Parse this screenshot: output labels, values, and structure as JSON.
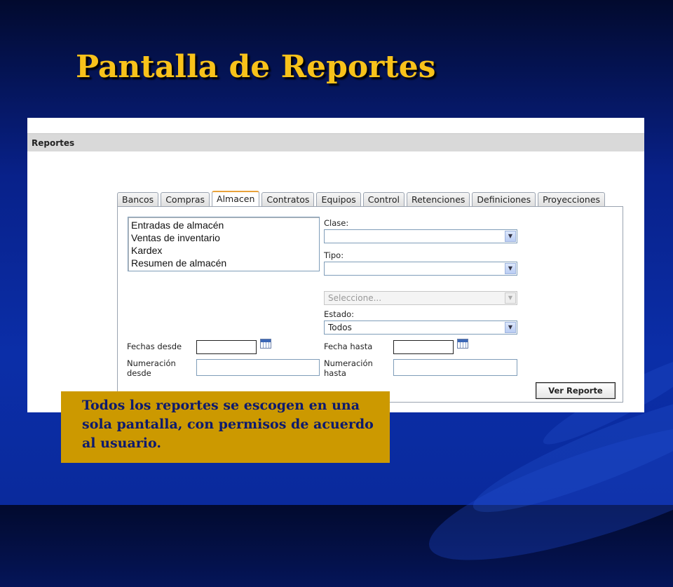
{
  "slide": {
    "title": "Pantalla de Reportes",
    "caption": "Todos los reportes se escogen en una sola pantalla, con permisos de acuerdo al usuario."
  },
  "app": {
    "header": "Reportes",
    "tabs": [
      {
        "label": "Bancos",
        "active": false
      },
      {
        "label": "Compras",
        "active": false
      },
      {
        "label": "Almacen",
        "active": true
      },
      {
        "label": "Contratos",
        "active": false
      },
      {
        "label": "Equipos",
        "active": false
      },
      {
        "label": "Control",
        "active": false
      },
      {
        "label": "Retenciones",
        "active": false
      },
      {
        "label": "Definiciones",
        "active": false
      },
      {
        "label": "Proyecciones",
        "active": false
      }
    ],
    "report_list": [
      "Entradas de almacén",
      "Ventas de inventario",
      "Kardex",
      "Resumen de almacén"
    ],
    "form": {
      "clase_label": "Clase:",
      "clase_value": "",
      "tipo_label": "Tipo:",
      "tipo_value": "",
      "extra_select_placeholder": "Seleccione...",
      "estado_label": "Estado:",
      "estado_value": "Todos",
      "fechas_desde_label": "Fechas desde",
      "fecha_hasta_label": "Fecha hasta",
      "numeracion_desde_label_1": "Numeración",
      "numeracion_desde_label_2": "desde",
      "numeracion_hasta_label_1": "Numeración",
      "numeracion_hasta_label_2": "hasta",
      "submit_label": "Ver Reporte"
    }
  },
  "colors": {
    "title": "#f8c21a",
    "callout_bg": "#cc9900",
    "callout_text": "#0d1a6e",
    "active_tab_accent": "#e8a23a"
  }
}
